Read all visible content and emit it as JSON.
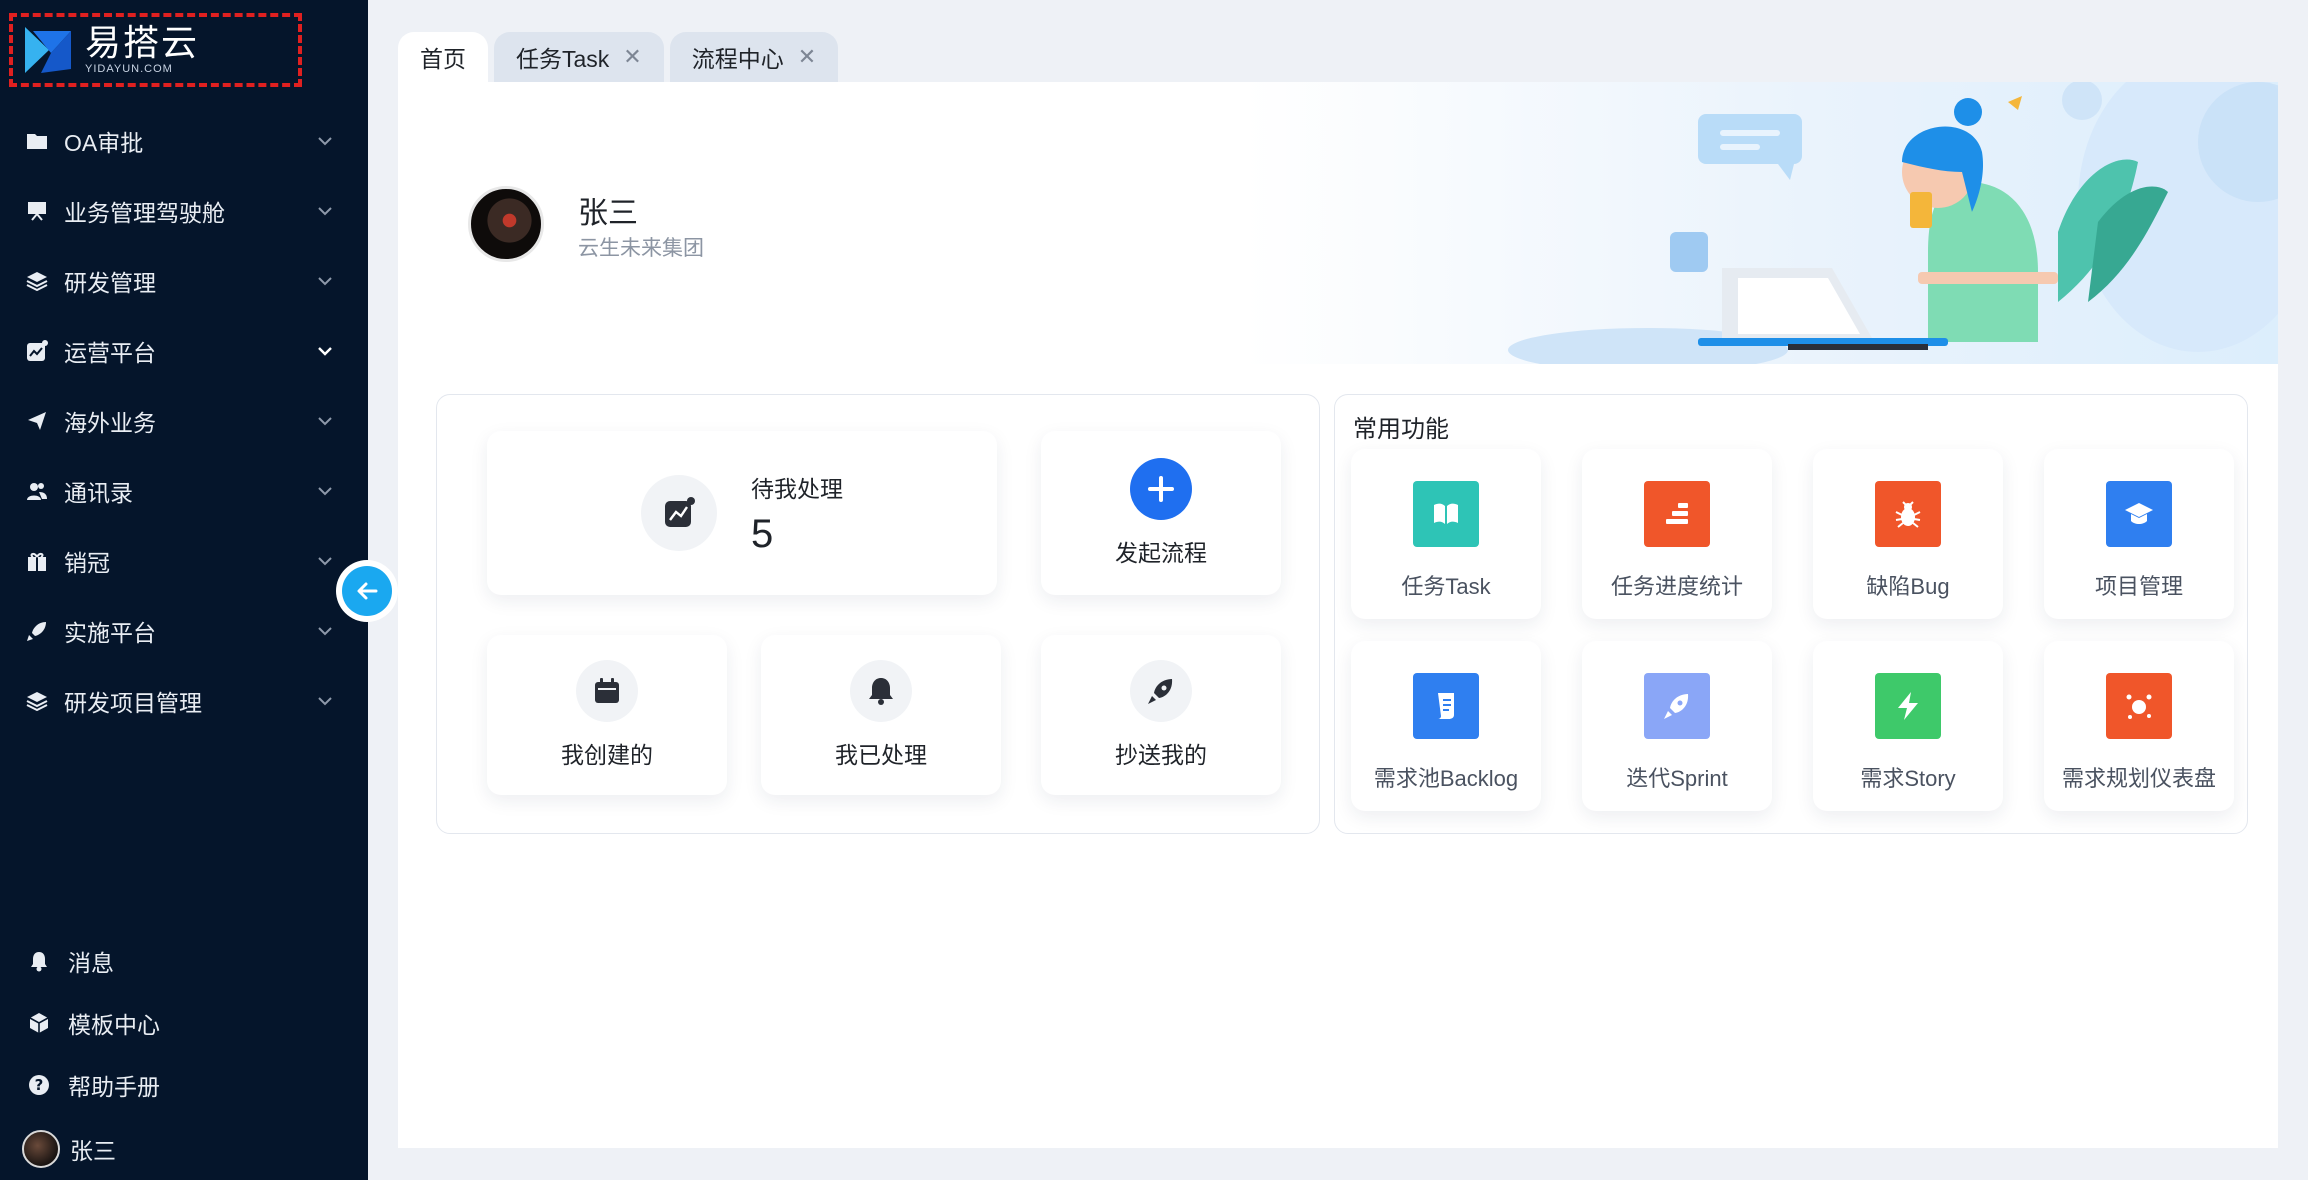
{
  "brand": {
    "name_cn": "易搭云",
    "name_en": "YIDAYUN.COM"
  },
  "sidebar": {
    "items": [
      {
        "label": "OA审批",
        "icon": "folder-icon"
      },
      {
        "label": "业务管理驾驶舱",
        "icon": "presentation-icon"
      },
      {
        "label": "研发管理",
        "icon": "layers-icon"
      },
      {
        "label": "运营平台",
        "icon": "chart-icon"
      },
      {
        "label": "海外业务",
        "icon": "plane-icon"
      },
      {
        "label": "通讯录",
        "icon": "contacts-icon"
      },
      {
        "label": "销冠",
        "icon": "gift-icon"
      },
      {
        "label": "实施平台",
        "icon": "rocket-icon"
      },
      {
        "label": "研发项目管理",
        "icon": "layers-icon"
      }
    ],
    "bottom": [
      {
        "label": "消息",
        "icon": "bell-icon"
      },
      {
        "label": "模板中心",
        "icon": "cube-icon"
      },
      {
        "label": "帮助手册",
        "icon": "help-icon"
      }
    ],
    "user_name": "张三"
  },
  "tabs": [
    {
      "label": "首页",
      "active": true,
      "closable": false
    },
    {
      "label": "任务Task",
      "active": false,
      "closable": true
    },
    {
      "label": "流程中心",
      "active": false,
      "closable": true
    }
  ],
  "profile": {
    "name": "张三",
    "org": "云生未来集团"
  },
  "stats": {
    "pending_label": "待我处理",
    "pending_count": "5",
    "start_label": "发起流程",
    "created_label": "我创建的",
    "processed_label": "我已处理",
    "cc_label": "抄送我的"
  },
  "functions": {
    "title": "常用功能",
    "items": [
      {
        "label": "任务Task",
        "color": "#2ec4b6",
        "icon": "book-icon"
      },
      {
        "label": "任务进度统计",
        "color": "#f0562a",
        "icon": "stairs-icon"
      },
      {
        "label": "缺陷Bug",
        "color": "#f0562a",
        "icon": "bug-icon"
      },
      {
        "label": "项目管理",
        "color": "#2f7ff0",
        "icon": "graduation-cap-icon"
      },
      {
        "label": "需求池Backlog",
        "color": "#2f7ff0",
        "icon": "scroll-icon"
      },
      {
        "label": "迭代Sprint",
        "color": "#8aa6f7",
        "icon": "rocket-icon"
      },
      {
        "label": "需求Story",
        "color": "#3ec96a",
        "icon": "lightning-icon"
      },
      {
        "label": "需求规划仪表盘",
        "color": "#f0562a",
        "icon": "dashboard-icon"
      }
    ]
  }
}
